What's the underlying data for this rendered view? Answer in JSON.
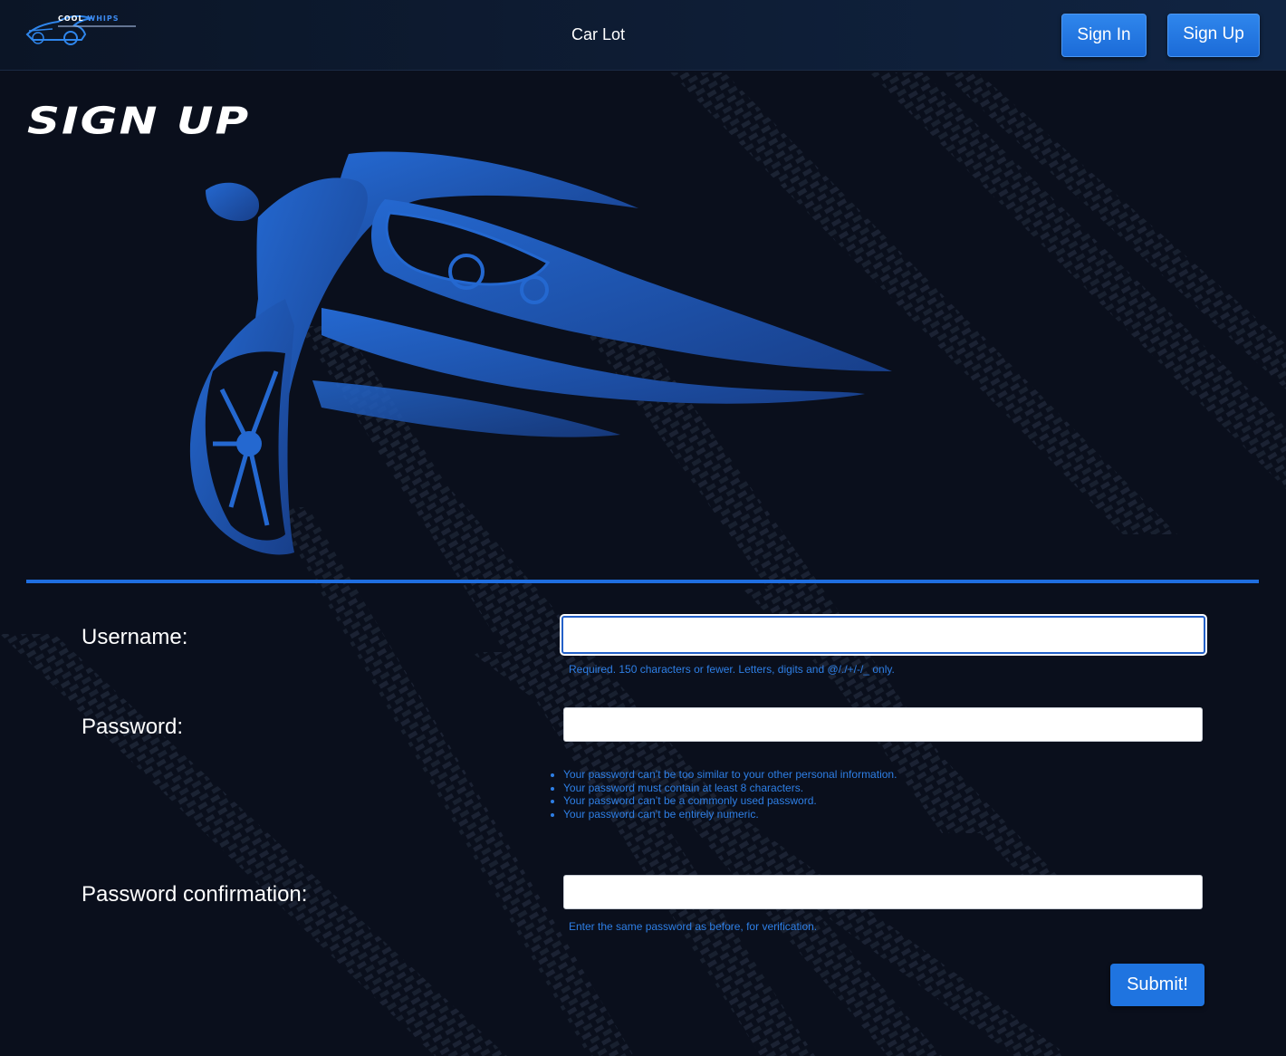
{
  "navbar": {
    "logo": {
      "word1": "COOL",
      "word2": "WHIPS"
    },
    "nav_link": "Car Lot",
    "sign_in_label": "Sign In",
    "sign_up_label": "Sign Up"
  },
  "page": {
    "title": "SIGN UP"
  },
  "form": {
    "username": {
      "label": "Username:",
      "value": "",
      "help": "Required. 150 characters or fewer. Letters, digits and @/./+/-/_ only."
    },
    "password": {
      "label": "Password:",
      "value": "",
      "help": [
        "Your password can’t be too similar to your other personal information.",
        "Your password must contain at least 8 characters.",
        "Your password can’t be a commonly used password.",
        "Your password can’t be entirely numeric."
      ]
    },
    "password_confirmation": {
      "label": "Password confirmation:",
      "value": "",
      "help": "Enter the same password as before, for verification."
    },
    "submit_label": "Submit!"
  },
  "colors": {
    "accent": "#1f74e0",
    "background": "#0a0f1c",
    "help_text": "#2e7fe6"
  }
}
